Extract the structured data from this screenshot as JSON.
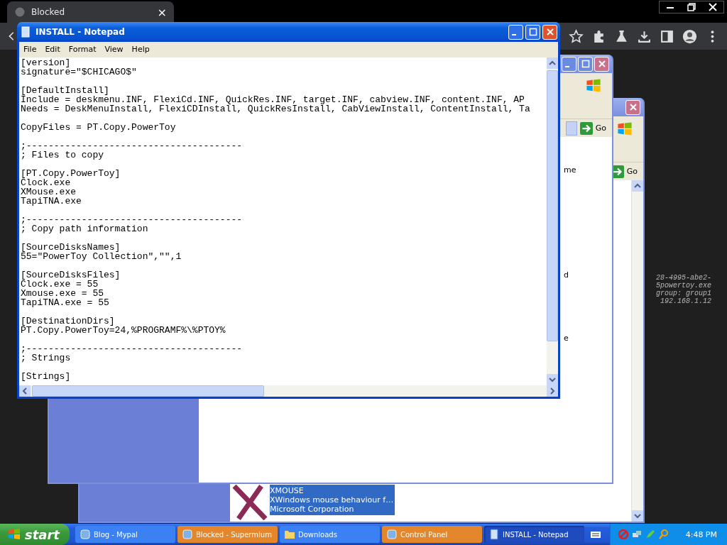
{
  "browser": {
    "tab_title": "Blocked",
    "tab_close": "×"
  },
  "bginfo": [
    "28-4995-abe2-",
    "5powertoy.exe",
    "group: group1",
    "192.168.1.12"
  ],
  "explorer_back": {
    "go_button": "Go",
    "item": {
      "title": "XMOUSE",
      "description": "XWindows mouse behaviour f…",
      "company": "Microsoft Corporation",
      "selected": true
    }
  },
  "explorer_front": {
    "go_button": "Go",
    "text_fragments": [
      "me",
      "d",
      "e"
    ]
  },
  "notepad": {
    "title": "INSTALL - Notepad",
    "menu": [
      "File",
      "Edit",
      "Format",
      "View",
      "Help"
    ],
    "blocks": [
      [
        "[version]",
        "signature=\"$CHICAGO$\""
      ],
      [
        "[DefaultInstall]",
        "Include = deskmenu.INF, FlexiCd.INF, QuickRes.INF, target.INF, cabview.INF, content.INF, AP",
        "Needs = DeskMenuInstall, FlexiCDInstall, QuickResInstall, CabViewInstall, ContentInstall, Ta"
      ],
      [
        "CopyFiles = PT.Copy.PowerToy"
      ],
      [
        ";---------------------------------------",
        "; Files to copy"
      ],
      [
        "[PT.Copy.PowerToy]",
        "Clock.exe",
        "XMouse.exe",
        "TapiTNA.exe"
      ],
      [
        ";---------------------------------------",
        "; Copy path information"
      ],
      [
        "[SourceDisksNames]",
        "55=\"PowerToy Collection\",\"\",1"
      ],
      [
        "[SourceDisksFiles]",
        "Clock.exe = 55",
        "Xmouse.exe = 55",
        "TapiTNA.exe = 55"
      ],
      [
        "[DestinationDirs]",
        "PT.Copy.PowerToy=24,%PROGRAMF%\\%PTOY%"
      ],
      [
        ";---------------------------------------",
        "; Strings"
      ],
      [
        "[Strings]"
      ]
    ]
  },
  "taskbar": {
    "start": "start",
    "items": [
      {
        "label": "Blog - Mypal",
        "flashing": false,
        "selected": false
      },
      {
        "label": "Blocked - Supermium",
        "flashing": true,
        "selected": false
      },
      {
        "label": "Downloads",
        "flashing": false,
        "selected": false
      },
      {
        "label": "Control Panel",
        "flashing": true,
        "selected": false
      },
      {
        "label": "INSTALL - Notepad",
        "flashing": false,
        "selected": true
      }
    ],
    "clock": "4:48 PM"
  }
}
